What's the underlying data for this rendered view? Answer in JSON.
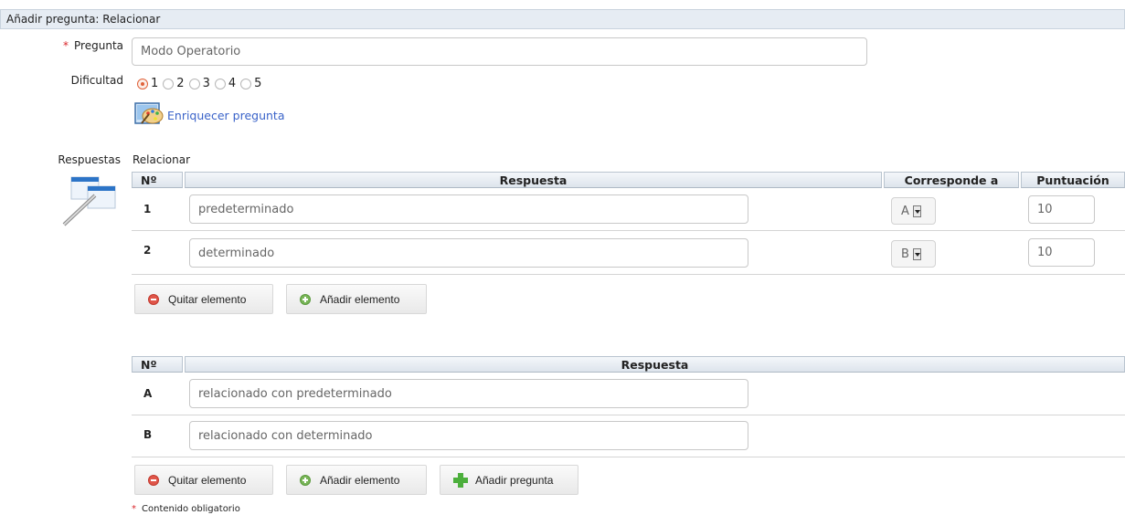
{
  "header": {
    "title": "Añadir pregunta: Relacionar"
  },
  "form": {
    "question_label": "Pregunta",
    "question_value": "Modo Operatorio",
    "difficulty_label": "Dificultad",
    "difficulty_options": [
      "1",
      "2",
      "3",
      "4",
      "5"
    ],
    "difficulty_selected": "1",
    "enrich_link": "Enriquecer pregunta",
    "answers_label": "Respuestas",
    "answers_type": "Relacionar"
  },
  "table1": {
    "headers": {
      "num": "Nº",
      "answer": "Respuesta",
      "corresponds": "Corresponde a",
      "score": "Puntuación"
    },
    "rows": [
      {
        "num": "1",
        "answer": "predeterminado",
        "corresponds": "A",
        "score": "10"
      },
      {
        "num": "2",
        "answer": "determinado",
        "corresponds": "B",
        "score": "10"
      }
    ],
    "remove_button": "Quitar elemento",
    "add_button": "Añadir elemento"
  },
  "table2": {
    "headers": {
      "num": "Nº",
      "answer": "Respuesta"
    },
    "rows": [
      {
        "num": "A",
        "answer": "relacionado con predeterminado"
      },
      {
        "num": "B",
        "answer": "relacionado con determinado"
      }
    ],
    "remove_button": "Quitar elemento",
    "add_button": "Añadir elemento",
    "add_question_button": "Añadir pregunta"
  },
  "footnote": "Contenido obligatorio",
  "colors": {
    "required": "#d9262b",
    "link": "#3a63c9",
    "radio_selected": "#e0623a",
    "header_bg": "#e6ecf3"
  }
}
